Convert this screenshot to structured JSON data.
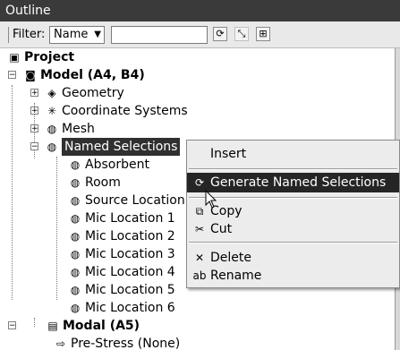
{
  "window": {
    "title": "Outline"
  },
  "filter": {
    "label": "Filter:",
    "selected": "Name",
    "input_value": ""
  },
  "tree": {
    "project": "Project",
    "model": "Model (A4, B4)",
    "geometry": "Geometry",
    "coordinate_systems": "Coordinate Systems",
    "mesh": "Mesh",
    "named_selections": "Named Selections",
    "children": [
      "Absorbent",
      "Room",
      "Source Location",
      "Mic Location 1",
      "Mic Location 2",
      "Mic Location 3",
      "Mic Location 4",
      "Mic Location 5",
      "Mic Location 6"
    ],
    "modal": "Modal (A5)",
    "prestress": "Pre-Stress (None)"
  },
  "context_menu": {
    "insert": "Insert",
    "generate": "Generate Named Selections",
    "copy": "Copy",
    "cut": "Cut",
    "delete": "Delete",
    "rename": "Rename"
  },
  "colors": {
    "titlebar": "#3a3a3a",
    "highlight": "#252525",
    "menu_bg": "#ececec"
  }
}
